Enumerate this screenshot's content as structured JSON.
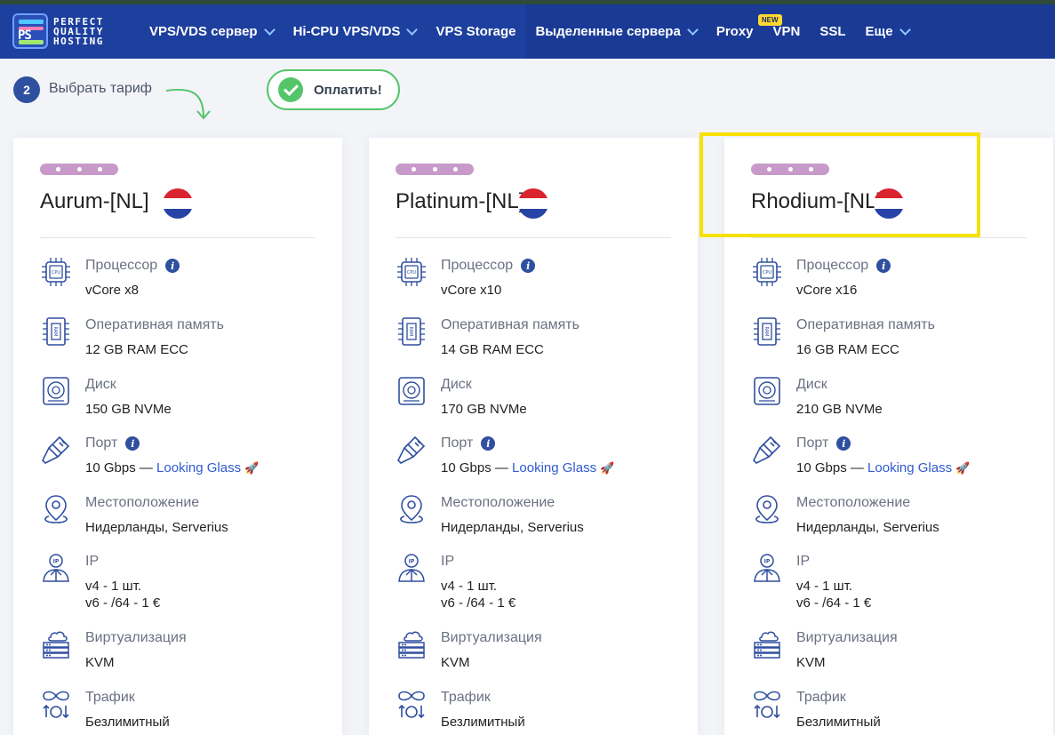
{
  "brand": {
    "line1": "PERFECT",
    "line2": "QUALITY",
    "line3": "HOSTING",
    "mark": "PS"
  },
  "nav": {
    "items": [
      {
        "label": "VPS/VDS сервер",
        "dropdown": true
      },
      {
        "label": "Hi-CPU VPS/VDS",
        "dropdown": true
      },
      {
        "label": "VPS Storage",
        "dropdown": false
      },
      {
        "label": "Выделенные сервера",
        "dropdown": true
      },
      {
        "label": "Proxy",
        "dropdown": false,
        "badge": "NEW"
      },
      {
        "label": "VPN",
        "dropdown": false
      },
      {
        "label": "SSL",
        "dropdown": false
      },
      {
        "label": "Еще",
        "dropdown": true
      }
    ]
  },
  "steps": {
    "number": "2",
    "label": "Выбрать тариф",
    "pay_label": "Оплатить!"
  },
  "colors": {
    "nav_bg": "#1d3f9e",
    "accent_green": "#55c56a",
    "highlight": "#f7e100",
    "link": "#2f5bd1"
  },
  "spec_labels": {
    "cpu": "Процессор",
    "ram": "Оперативная память",
    "disk": "Диск",
    "port": "Порт",
    "location": "Местоположение",
    "ip": "IP",
    "virt": "Виртуализация",
    "traffic": "Трафик"
  },
  "plans": [
    {
      "name": "Aurum-[NL]",
      "cpu": "vCore x8",
      "ram": "12 GB RAM ECC",
      "disk": "150 GB NVMe",
      "port": "10 Gbps —",
      "port_link": "Looking Glass",
      "location": "Нидерланды, Serverius",
      "ip_v4": "v4 - 1 шт.",
      "ip_v6": "v6 - /64 - 1 €",
      "virt": "KVM",
      "traffic": "Безлимитный"
    },
    {
      "name": "Platinum-[NL]",
      "cpu": "vCore x10",
      "ram": "14 GB RAM ECC",
      "disk": "170 GB NVMe",
      "port": "10 Gbps —",
      "port_link": "Looking Glass",
      "location": "Нидерланды, Serverius",
      "ip_v4": "v4 - 1 шт.",
      "ip_v6": "v6 - /64 - 1 €",
      "virt": "KVM",
      "traffic": "Безлимитный"
    },
    {
      "name": "Rhodium-[NL]",
      "cpu": "vCore x16",
      "ram": "16 GB RAM ECC",
      "disk": "210 GB NVMe",
      "port": "10 Gbps —",
      "port_link": "Looking Glass",
      "location": "Нидерланды, Serverius",
      "ip_v4": "v4 - 1 шт.",
      "ip_v6": "v6 - /64 - 1 €",
      "virt": "KVM",
      "traffic": "Безлимитный"
    }
  ]
}
